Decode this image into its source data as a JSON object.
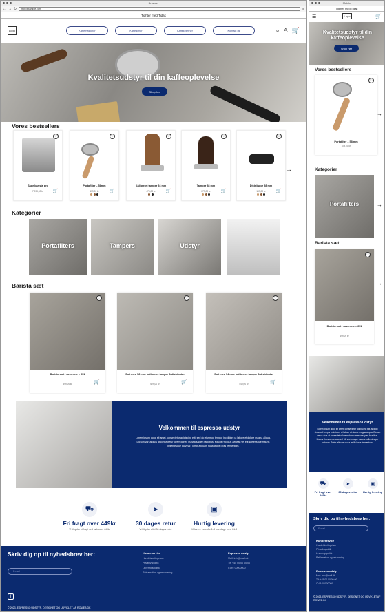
{
  "browser": {
    "title": "Browser",
    "url": "http://example.com",
    "mobile_title": "Mobile"
  },
  "promo": "Tighter med Tidak",
  "header": {
    "logo": "Logo",
    "nav": [
      "Kaffemaskiner",
      "Kaffedimer",
      "Kaffekværner",
      "Kontakt os"
    ]
  },
  "hero": {
    "title": "Kvalitetsudstyr til din kaffeoplevelse",
    "cta": "Shop her"
  },
  "bestsellers": {
    "title": "Vores bestsellers",
    "items": [
      {
        "name": "Sage barista pro",
        "price": "7.999,00 kr"
      },
      {
        "name": "Portafilter – 58mm",
        "price": "479,00 kr",
        "swatches": [
          "#c99a6b",
          "#8a5a34",
          "#222222"
        ]
      },
      {
        "name": "Kalibreret tamper 54 mm",
        "price": "479,00 kr",
        "swatches": [
          "#8a5a34",
          "#222222"
        ]
      },
      {
        "name": "Tamper 58 mm",
        "price": "279,00 kr",
        "swatches": [
          "#c99a6b",
          "#8a5a34",
          "#222222"
        ]
      },
      {
        "name": "Distributor 58 mm",
        "price": "199,00 kr",
        "swatches": [
          "#c99a6b",
          "#8a5a34",
          "#222222"
        ]
      }
    ]
  },
  "categories": {
    "title": "Kategorier",
    "items": [
      "Portafilters",
      "Tampers",
      "Udstyr",
      ""
    ]
  },
  "barista": {
    "title": "Barista sæt",
    "items": [
      {
        "name": "Barista sæt i rosentræ – 651",
        "price": "599,00 kr"
      },
      {
        "name": "Sæt med 58 mm. kalibreret tamper & distributør",
        "price": "629,00 kr"
      },
      {
        "name": "Sæt med 54 mm. kalibreret tamper & distributør",
        "price": "549,00 kr"
      }
    ]
  },
  "welcome": {
    "title": "Velkommen til espresso udstyr",
    "body": "Lorem ipsum dolor sit amet, consectetur adipiscing elit, sed do eiusmod tempor incididunt ut labore et dolore magna aliqua. Dictum varius duis at consectetur lorem donec massa sapien faucibus. Mauris rhoncus aenean vel elit scelerisque mauris pellentesque pulvinar. Tortor aliquam nulla facilisi cras fermentum."
  },
  "features": [
    {
      "title": "Fri fragt over 449kr",
      "text": "Vi tilbyder fri fragt ved køb over 449kr"
    },
    {
      "title": "30 dages retur",
      "text": "Vi tilbyder altid 30 dages retur"
    },
    {
      "title": "Hurtig levering",
      "text": "Vi levere indenfor 1-3 hverdage med GLS"
    }
  ],
  "footer": {
    "newsletter": "Skriv dig op til nyhedsbrev her:",
    "email_placeholder": "E-mail",
    "col1": {
      "title": "Kundeservice",
      "links": [
        "Handelsbetingelser",
        "Privatlivspolitik",
        "Leveringspolitik",
        "Reklamation og returnering"
      ]
    },
    "col2": {
      "title": "Espresso udstyr",
      "lines": [
        "Mail: info@mail.dk",
        "Tlf: +45 00 00 00 00",
        "CVR: 00000000"
      ]
    },
    "copyright": "© 2023, ESPRESSO UDSTYR. DESIGNET OG UDVIKLET AF ROWEB.DK"
  },
  "mobile": {
    "bestseller_item": {
      "name": "Portafilter – 58 mm",
      "price": "479,00 kr"
    },
    "barista_item": {
      "name": "Barista sæt i rosentræ – 651",
      "price": "699,00 kr"
    },
    "features": [
      "Fri fragt over 449kr",
      "30 dages retur",
      "Hurtig levering"
    ],
    "copyright": "© 2023, ESPRESSO UDSTYR. DESIGNET OG UDVIKLET AF ROWEB.DK"
  },
  "colors": {
    "brand": "#0b2a6f",
    "nav_border": "#3c4b8a"
  }
}
